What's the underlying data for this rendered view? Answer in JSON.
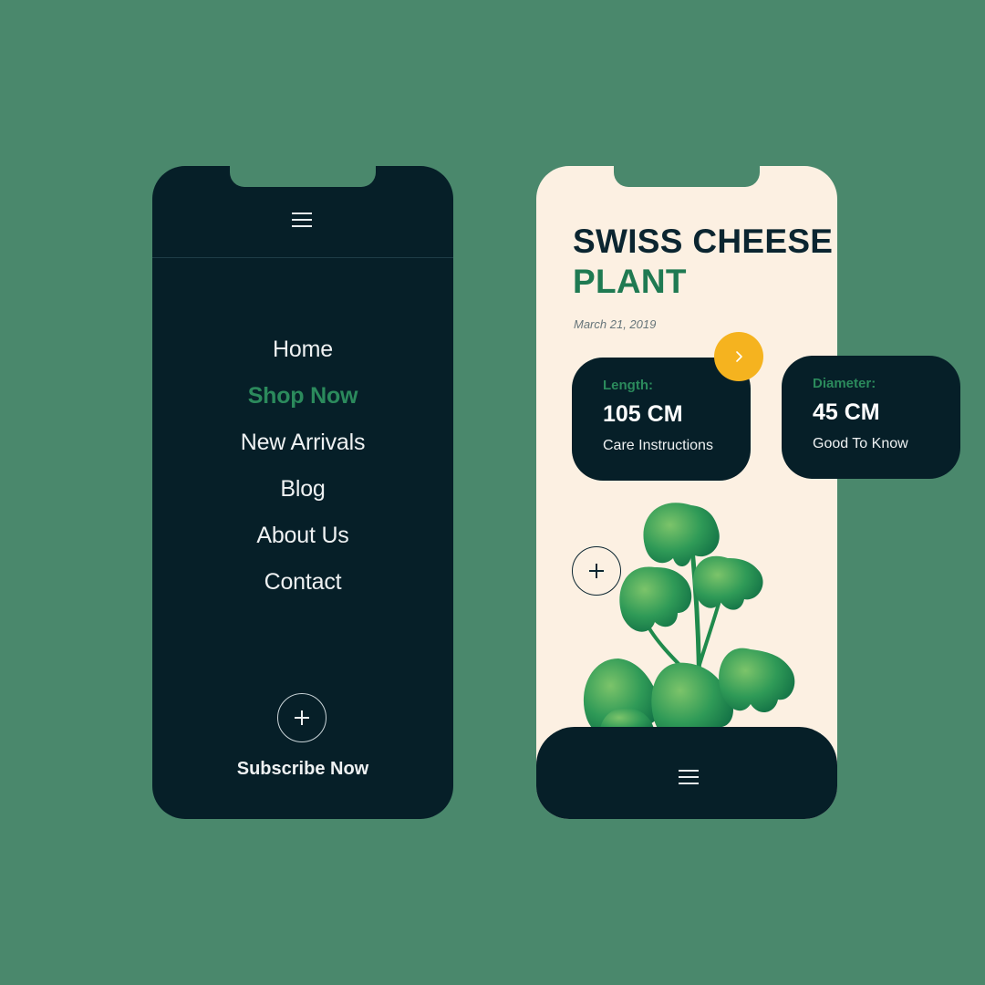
{
  "menu_phone": {
    "menu_items": [
      {
        "label": "Home",
        "active": false
      },
      {
        "label": "Shop Now",
        "active": true
      },
      {
        "label": "New Arrivals",
        "active": false
      },
      {
        "label": "Blog",
        "active": false
      },
      {
        "label": "About Us",
        "active": false
      },
      {
        "label": "Contact",
        "active": false
      }
    ],
    "subscribe_label": "Subscribe Now",
    "plus_icon": "plus-icon",
    "menu_icon": "hamburger-menu-icon"
  },
  "product_phone": {
    "title_line1": "SWISS CHEESE",
    "title_line2": "PLANT",
    "date": "March 21, 2019",
    "plus_icon": "plus-icon",
    "menu_icon": "hamburger-menu-icon",
    "next_icon": "chevron-right-icon"
  },
  "cards": {
    "length": {
      "label": "Length:",
      "value": "105 CM",
      "subtitle": "Care Instructions"
    },
    "diameter": {
      "label": "Diameter:",
      "value": "45 CM",
      "subtitle": "Good To Know"
    }
  },
  "colors": {
    "background": "#4a886c",
    "dark": "#061f28",
    "cream": "#fcf0e2",
    "accent_green": "#2b8a5c",
    "accent_yellow": "#f5b31f"
  }
}
